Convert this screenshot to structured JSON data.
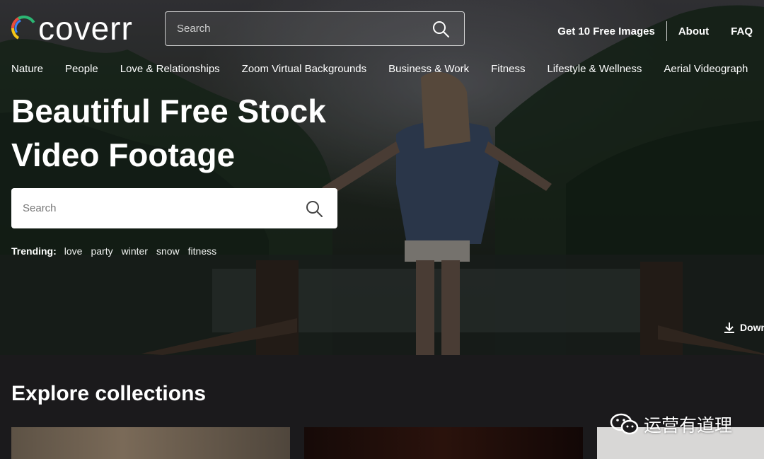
{
  "header": {
    "logo_text": "coverr",
    "logo_colors": [
      "#f5c518",
      "#e84c3d",
      "#2bb673",
      "#3b82f6"
    ],
    "search_placeholder": "Search",
    "links": {
      "free_images": "Get 10 Free Images",
      "about": "About",
      "faq": "FAQ"
    }
  },
  "categories": [
    "Nature",
    "People",
    "Love & Relationships",
    "Zoom Virtual Backgrounds",
    "Business & Work",
    "Fitness",
    "Lifestyle & Wellness",
    "Aerial Videograph"
  ],
  "hero": {
    "title_line1": "Beautiful Free Stock",
    "title_line2": "Video Footage",
    "search_placeholder": "Search",
    "trending_label": "Trending:",
    "trending_tags": [
      "love",
      "party",
      "winter",
      "snow",
      "fitness"
    ],
    "download_label": "Down"
  },
  "explore": {
    "title": "Explore collections"
  },
  "watermark": {
    "text": "运营有道理",
    "icon": "wechat-icon"
  },
  "colors": {
    "page_bg": "#1b1a1c",
    "text": "#ffffff"
  }
}
